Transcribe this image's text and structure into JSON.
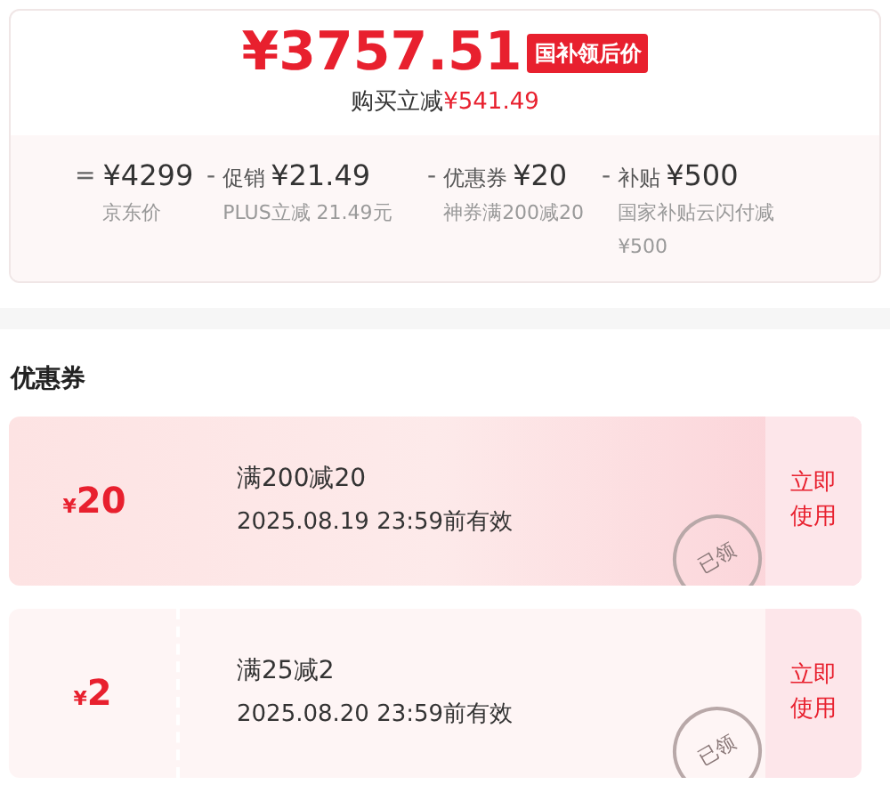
{
  "price": {
    "amount": "¥3757.51",
    "tag": "国补领后价",
    "saving_label": "购买立减",
    "saving": "¥541.49"
  },
  "breakdown": [
    {
      "op": "=",
      "amount": "¥4299",
      "note": "京东价"
    },
    {
      "op": "-",
      "label": "促销",
      "amount": "¥21.49",
      "note": "PLUS立减 21.49元"
    },
    {
      "op": "-",
      "label": "优惠券",
      "amount": "¥20",
      "note": "神券满200减20"
    },
    {
      "op": "-",
      "label": "补贴",
      "amount": "¥500",
      "note": "国家补贴云闪付减¥500"
    }
  ],
  "coupons_title": "优惠券",
  "coupons": [
    {
      "currency": "¥",
      "value": "20",
      "condition": "满200减20",
      "validity": "2025.08.19 23:59前有效",
      "stamp": "已领",
      "action": "立即使用",
      "highlighted": true
    },
    {
      "currency": "¥",
      "value": "2",
      "condition": "满25减2",
      "validity": "2025.08.20 23:59前有效",
      "stamp": "已领",
      "action": "立即使用",
      "highlighted": false
    }
  ]
}
